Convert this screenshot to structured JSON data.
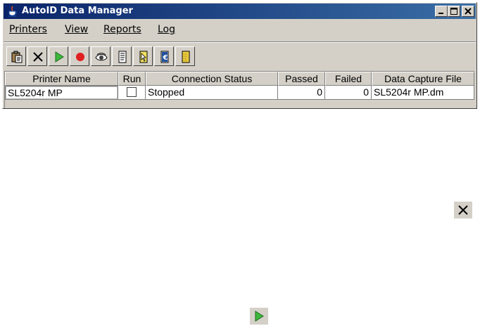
{
  "window": {
    "title": "AutoID Data Manager"
  },
  "menu": [
    {
      "label": "Printers"
    },
    {
      "label": "View"
    },
    {
      "label": "Reports"
    },
    {
      "label": "Log"
    }
  ],
  "toolbar": [
    "clipboard-icon",
    "close-x-icon",
    "play-icon",
    "record-icon",
    "eye-icon",
    "document-icon",
    "pointer-document-icon",
    "euro-document-icon",
    "card-icon"
  ],
  "table": {
    "columns": [
      "Printer Name",
      "Run",
      "Connection Status",
      "Passed",
      "Failed",
      "Data Capture File"
    ],
    "rows": [
      {
        "printer_name": "SL5204r MP",
        "run": false,
        "status": "Stopped",
        "passed": "0",
        "failed": "0",
        "file": "SL5204r MP.dm"
      }
    ]
  },
  "floating_icons": [
    "close-x-icon",
    "play-icon"
  ],
  "colors": {
    "title_bar": "#0a246a",
    "play_green": "#3cb83c",
    "record_red": "#e02020",
    "face": "#d4d0c8"
  }
}
